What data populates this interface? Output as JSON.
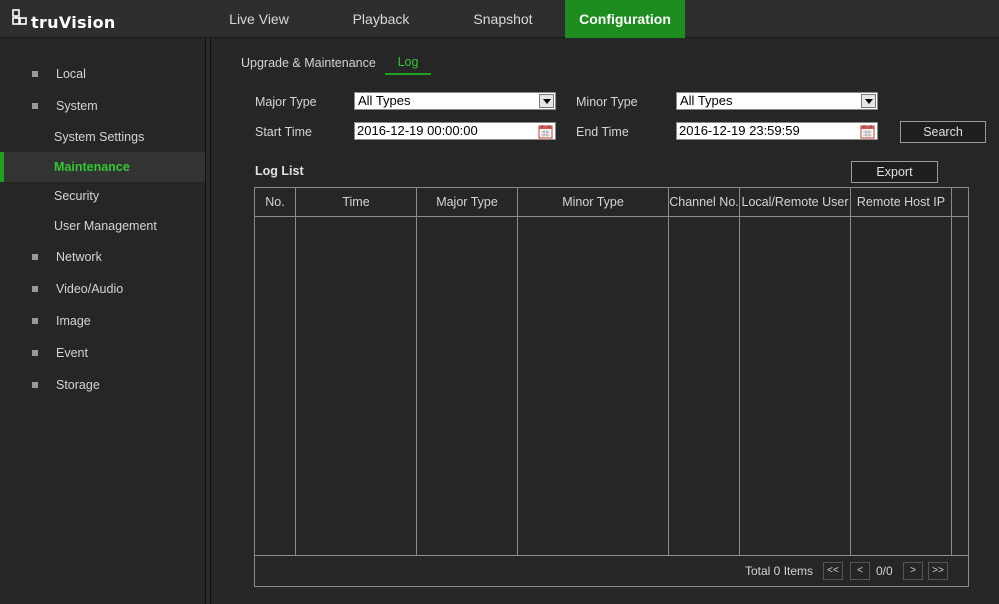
{
  "app": {
    "logo_text": "truVision",
    "nav": [
      {
        "label": "Live View"
      },
      {
        "label": "Playback"
      },
      {
        "label": "Snapshot"
      },
      {
        "label": "Configuration"
      }
    ]
  },
  "sidebar": {
    "items": [
      {
        "label": "Local"
      },
      {
        "label": "System"
      },
      {
        "label": "System Settings"
      },
      {
        "label": "Maintenance"
      },
      {
        "label": "Security"
      },
      {
        "label": "User Management"
      },
      {
        "label": "Network"
      },
      {
        "label": "Video/Audio"
      },
      {
        "label": "Image"
      },
      {
        "label": "Event"
      },
      {
        "label": "Storage"
      }
    ]
  },
  "subtabs": [
    {
      "label": "Upgrade & Maintenance"
    },
    {
      "label": "Log"
    }
  ],
  "filters": {
    "major_type_label": "Major Type",
    "major_type_value": "All Types",
    "minor_type_label": "Minor Type",
    "minor_type_value": "All Types",
    "start_time_label": "Start Time",
    "start_time_value": "2016-12-19 00:00:00",
    "end_time_label": "End Time",
    "end_time_value": "2016-12-19 23:59:59",
    "search_label": "Search"
  },
  "log_list": {
    "title": "Log List",
    "export_label": "Export",
    "columns": [
      "No.",
      "Time",
      "Major Type",
      "Minor Type",
      "Channel No.",
      "Local/Remote User",
      "Remote Host IP"
    ],
    "total_text": "Total 0 Items",
    "page_info": "0/0",
    "pager": {
      "first": "<<",
      "prev": "<",
      "next": ">",
      "last": ">>"
    }
  },
  "colors": {
    "accent": "#1c8d1e",
    "accent_text": "#32c832",
    "background": "#262626"
  }
}
